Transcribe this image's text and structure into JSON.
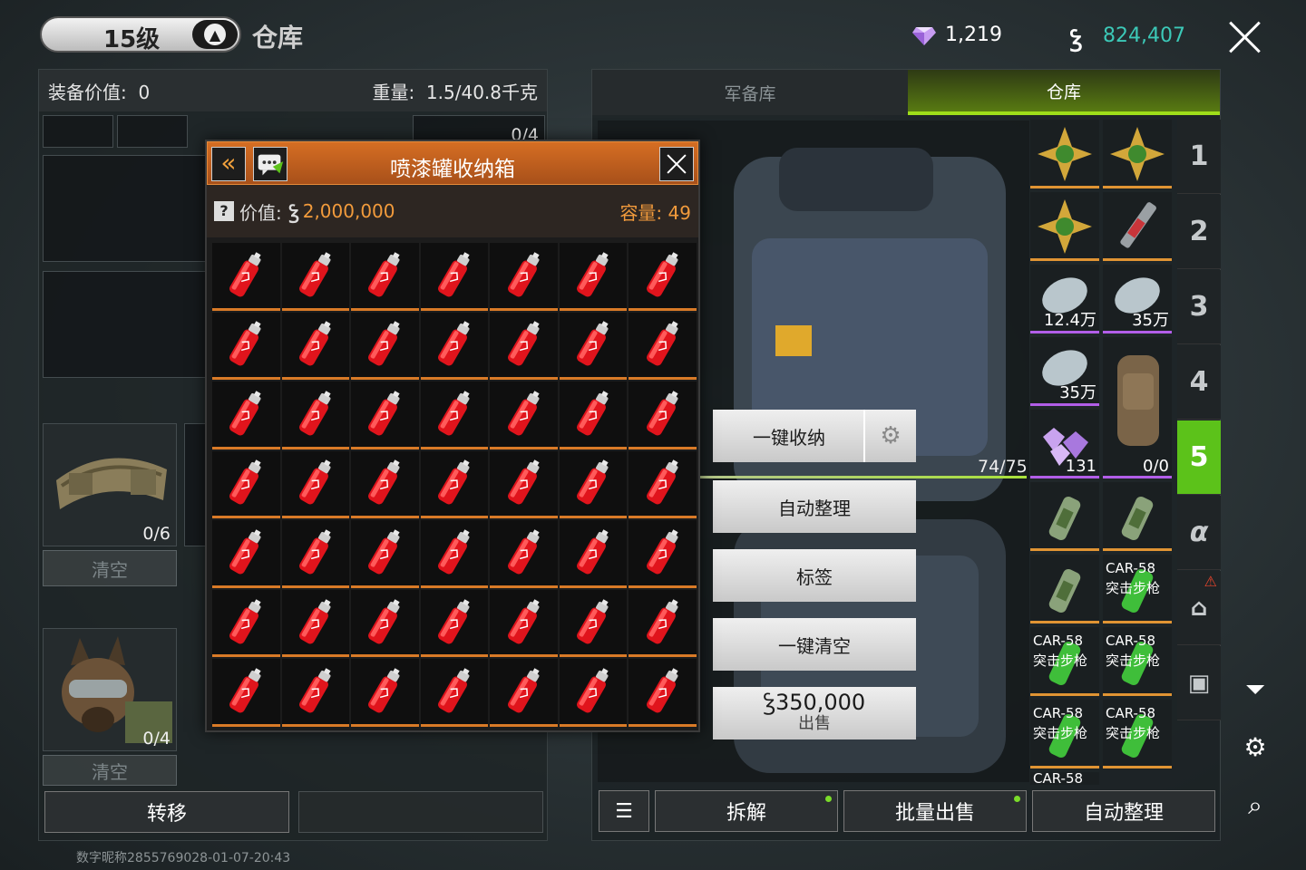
{
  "topbar": {
    "level": "15级",
    "title": "仓库",
    "gems": "1,219",
    "coins": "824,407"
  },
  "left": {
    "equip_label": "装备价值:",
    "equip_value": "0",
    "weight_label": "重量:",
    "weight_value": "1.5/40.8千克",
    "top_slot_count": "0/4",
    "belt_count": "0/6",
    "dog_count": "0/4",
    "clear_label": "清空",
    "transfer_label": "转移"
  },
  "popup": {
    "title": "喷漆罐收纳箱",
    "value_label": "价值:",
    "value_amount": "2,000,000",
    "capacity_label": "容量:",
    "capacity_value": "49"
  },
  "right": {
    "tab_armory": "军备库",
    "tab_warehouse": "仓库",
    "quick_store": "一键收纳",
    "auto_sort": "自动整理",
    "tags": "标签",
    "clear_all": "一键清空",
    "sell_price": "350,000",
    "sell_label": "出售",
    "bag_count": "74/75",
    "items": {
      "wrap1": "12.4万",
      "wrap2": "35万",
      "wrap3": "35万",
      "gems": "131",
      "bag": "0/0",
      "car_name": "CAR-58",
      "car_type": "突击步枪"
    },
    "side_tabs": [
      "1",
      "2",
      "3",
      "4",
      "5",
      "α"
    ],
    "bottom": {
      "dismantle": "拆解",
      "bulk_sell": "批量出售",
      "auto_sort": "自动整理"
    }
  },
  "footer": "数字昵称2855769028-01-07-20:43",
  "colors": {
    "accent_orange": "#d56e23",
    "accent_green": "#5cc21a",
    "coin_teal": "#3cc9b8"
  }
}
